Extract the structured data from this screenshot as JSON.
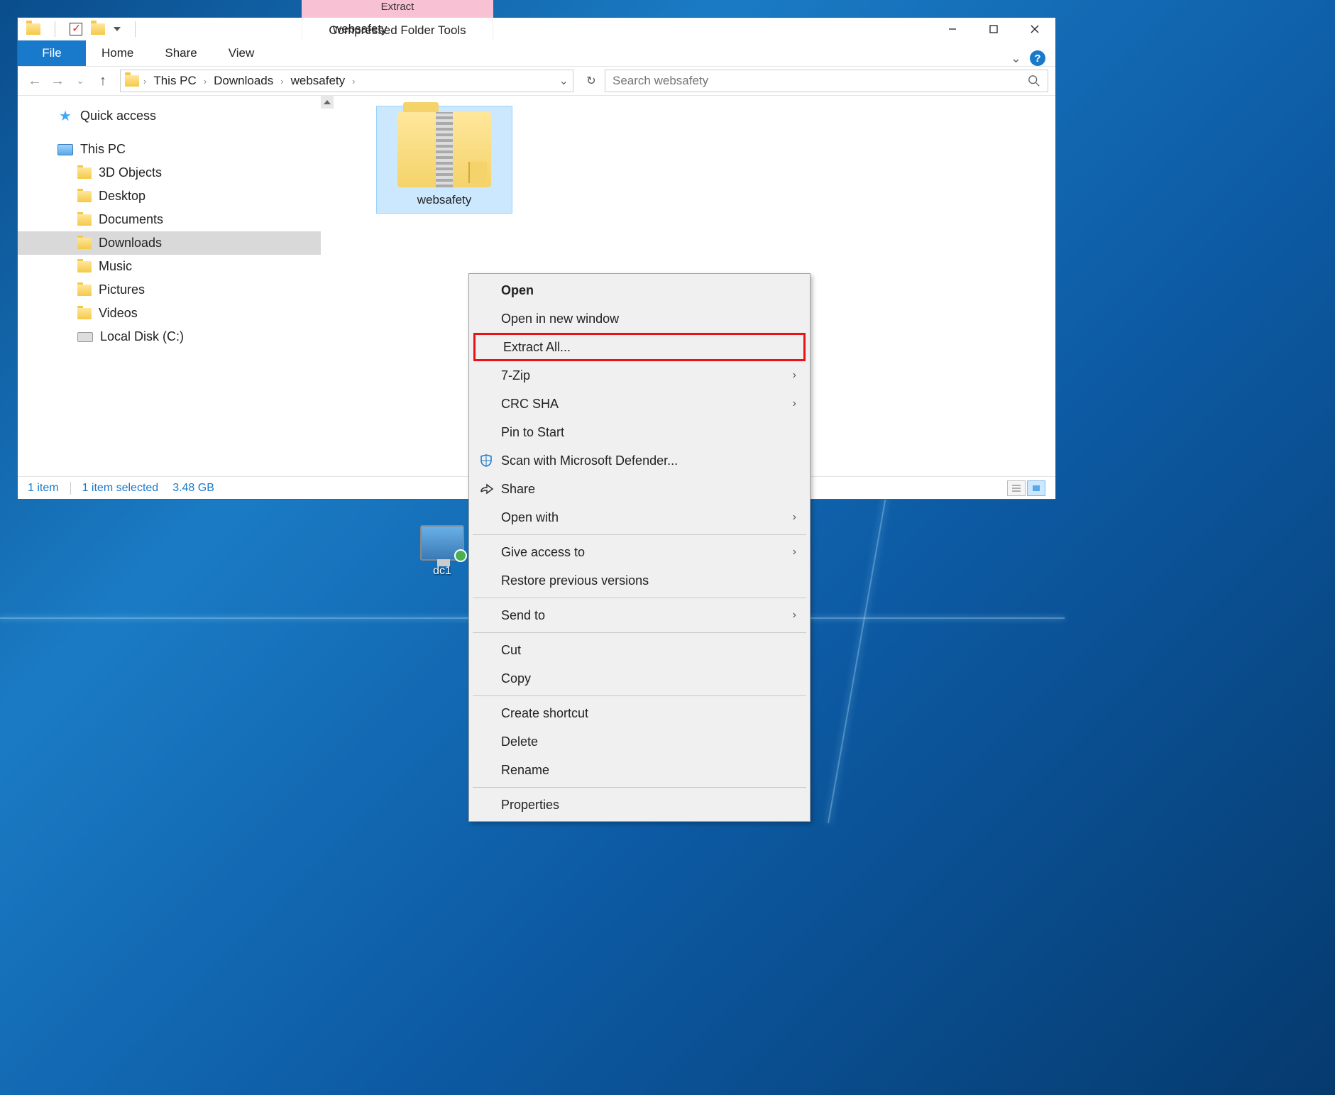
{
  "window": {
    "title": "websafety"
  },
  "tabs": {
    "file": "File",
    "home": "Home",
    "share": "Share",
    "view": "View",
    "context_header": "Extract",
    "context_tab": "Compressed Folder Tools"
  },
  "breadcrumbs": {
    "thispc": "This PC",
    "downloads": "Downloads",
    "websafety": "websafety"
  },
  "search": {
    "placeholder": "Search websafety"
  },
  "tree": {
    "quick_access": "Quick access",
    "this_pc": "This PC",
    "objects3d": "3D Objects",
    "desktop": "Desktop",
    "documents": "Documents",
    "downloads": "Downloads",
    "music": "Music",
    "pictures": "Pictures",
    "videos": "Videos",
    "local_disk": "Local Disk (C:)"
  },
  "file": {
    "name": "websafety"
  },
  "status": {
    "count": "1 item",
    "selected": "1 item selected",
    "size": "3.48 GB"
  },
  "context_menu": {
    "open": "Open",
    "open_new": "Open in new window",
    "extract_all": "Extract All...",
    "seven_zip": "7-Zip",
    "crc_sha": "CRC SHA",
    "pin_start": "Pin to Start",
    "scan": "Scan with Microsoft Defender...",
    "share": "Share",
    "open_with": "Open with",
    "give_access": "Give access to",
    "restore": "Restore previous versions",
    "send_to": "Send to",
    "cut": "Cut",
    "copy": "Copy",
    "shortcut": "Create shortcut",
    "delete": "Delete",
    "rename": "Rename",
    "properties": "Properties"
  },
  "desktop": {
    "dc1": "dc1"
  }
}
